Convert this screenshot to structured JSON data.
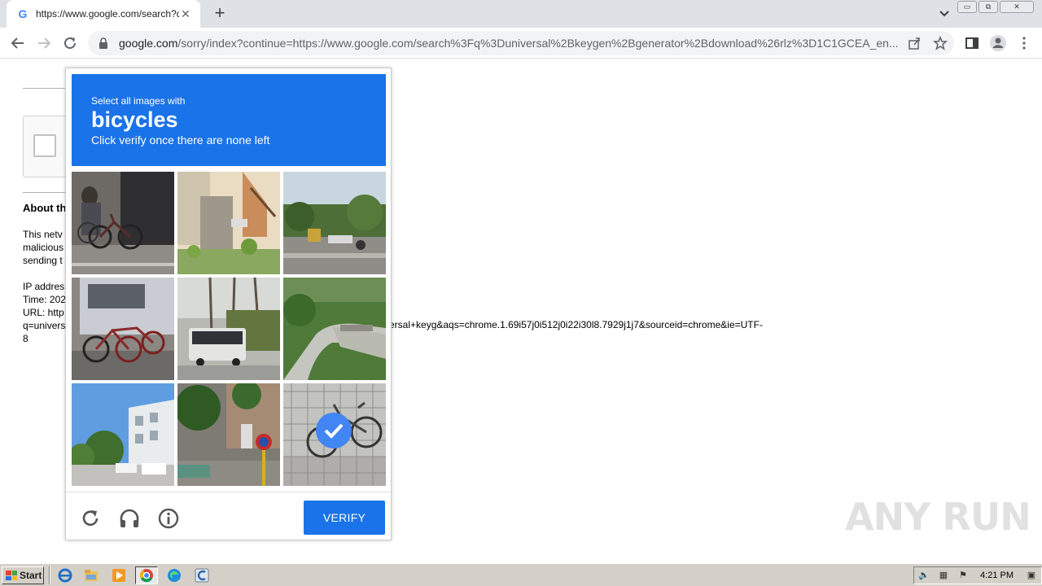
{
  "browser": {
    "tab_title": "https://www.google.com/search?q=",
    "tab_close": "✕",
    "new_tab": "+",
    "url_host": "google.com",
    "url_path": "/sorry/index?continue=https://www.google.com/search%3Fq%3Duniversal%2Bkeygen%2Bgenerator%2Bdownload%26rlz%3D1C1GCEA_en...",
    "window_buttons": [
      "▭",
      "⧉",
      "✕"
    ]
  },
  "page": {
    "about_heading": "About th",
    "para1": [
      "This netv",
      "malicious",
      "sending t"
    ],
    "para2": [
      "IP addres",
      "Time: 202",
      "URL: http",
      "q=univers",
      "8"
    ],
    "url_tail": "ersal+keyg&aqs=chrome.1.69i57j0i512j0i22i30l8.7929j1j7&sourceid=chrome&ie=UTF-"
  },
  "captcha": {
    "header_small": "Select all images with",
    "header_object": "bicycles",
    "header_sub": "Click verify once there are none left",
    "verify_label": "VERIFY",
    "tiles": [
      {
        "name": "tile-1",
        "selected": false
      },
      {
        "name": "tile-2",
        "selected": false
      },
      {
        "name": "tile-3",
        "selected": false
      },
      {
        "name": "tile-4",
        "selected": false
      },
      {
        "name": "tile-5",
        "selected": false
      },
      {
        "name": "tile-6",
        "selected": false
      },
      {
        "name": "tile-7",
        "selected": false
      },
      {
        "name": "tile-8",
        "selected": false
      },
      {
        "name": "tile-9",
        "selected": true
      }
    ],
    "footer_icons": [
      "reload-icon",
      "audio-icon",
      "info-icon"
    ],
    "accent": "#1a73e8"
  },
  "watermark": "ANY RUN",
  "taskbar": {
    "start_label": "Start",
    "clock": "4:21 PM",
    "apps": [
      "ie-icon",
      "explorer-icon",
      "media-player-icon",
      "chrome-icon",
      "edge-icon",
      "ccleaner-icon"
    ]
  }
}
